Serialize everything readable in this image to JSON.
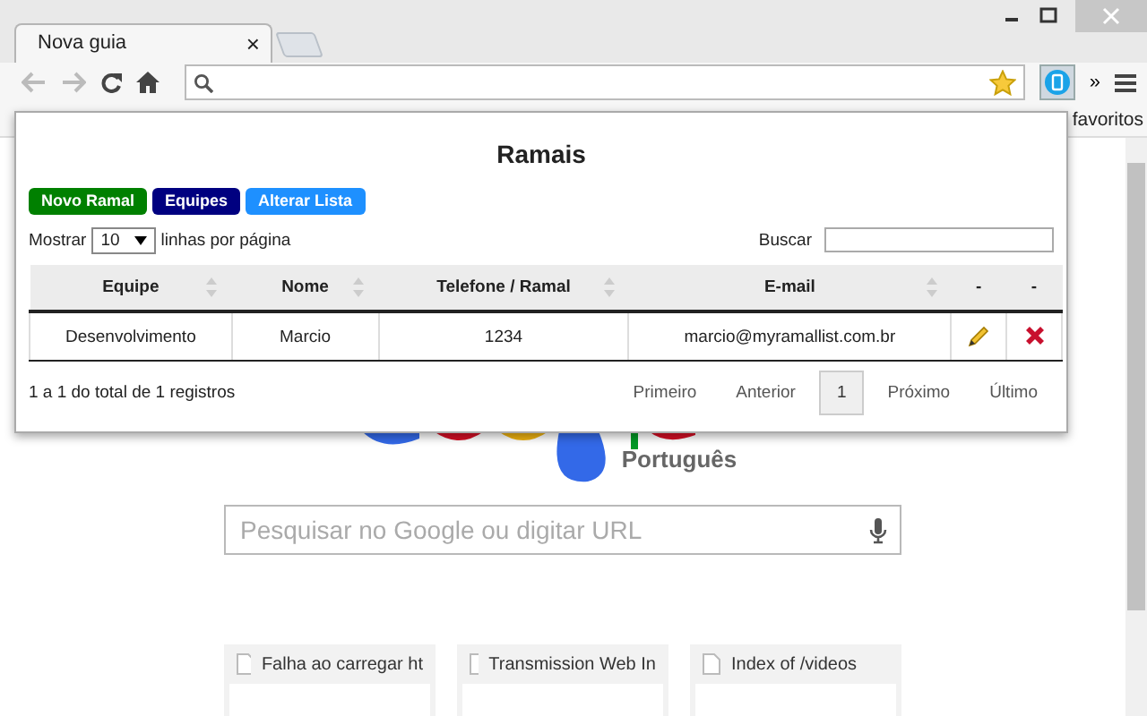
{
  "window": {
    "tab": {
      "title": "Nova guia",
      "close": "×"
    },
    "toolbar": {
      "more": "»"
    },
    "bookmarks_bar": {
      "label": "favoritos"
    }
  },
  "new_tab_page": {
    "logo_sub": "Português",
    "search": {
      "placeholder": "Pesquisar no Google ou digitar URL"
    },
    "thumbnails": [
      {
        "title": "Falha ao carregar ht"
      },
      {
        "title": "Transmission Web In"
      },
      {
        "title": "Index of /videos"
      }
    ]
  },
  "popup": {
    "title": "Ramais",
    "buttons": [
      {
        "label": "Novo Ramal",
        "color": "#008000"
      },
      {
        "label": "Equipes",
        "color": "#000080"
      },
      {
        "label": "Alterar Lista",
        "color": "#1e90ff"
      }
    ],
    "show_label": "Mostrar",
    "page_size": "10",
    "per_page_label": "linhas por página",
    "search_label": "Buscar",
    "columns": [
      {
        "label": "Equipe",
        "sortable": true
      },
      {
        "label": "Nome",
        "sortable": true
      },
      {
        "label": "Telefone / Ramal",
        "sortable": true
      },
      {
        "label": "E-mail",
        "sortable": true
      },
      {
        "label": "-",
        "sortable": false
      },
      {
        "label": "-",
        "sortable": false
      }
    ],
    "rows": [
      {
        "cells": [
          "Desenvolvimento",
          "Marcio",
          "1234",
          "marcio@myramallist.com.br"
        ]
      }
    ],
    "info": "1 a 1 do total de 1 registros",
    "pagination": [
      {
        "label": "Primeiro",
        "selected": false
      },
      {
        "label": "Anterior",
        "selected": false
      },
      {
        "label": "1",
        "selected": true
      },
      {
        "label": "Próximo",
        "selected": false
      },
      {
        "label": "Último",
        "selected": false
      }
    ]
  }
}
